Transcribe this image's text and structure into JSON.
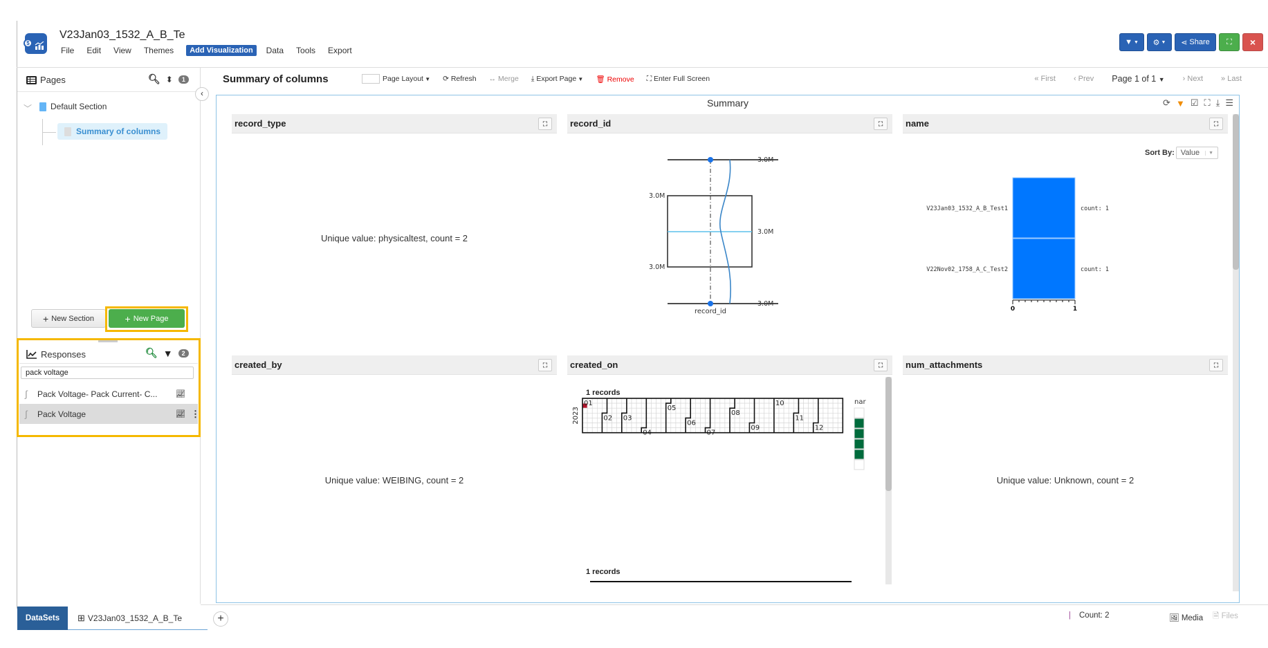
{
  "app": {
    "title": "V23Jan03_1532_A_B_Te",
    "menu": [
      "File",
      "Edit",
      "View",
      "Themes",
      "Add Visualization",
      "Data",
      "Tools",
      "Export"
    ],
    "active_menu": "Add Visualization",
    "top_buttons": {
      "filter": "filter-dropdown",
      "settings": "settings-dropdown",
      "share": "Share",
      "fullscreen": "fullscreen",
      "close": "×"
    }
  },
  "sidebar": {
    "pages_label": "Pages",
    "pages_badge": "1",
    "section": "Default Section",
    "page": "Summary of columns",
    "new_section": "New Section",
    "new_page": "New Page",
    "responses_label": "Responses",
    "responses_badge": "2",
    "search_value": "pack voltage",
    "responses": [
      {
        "name": "Pack Voltage- Pack Current- C...",
        "selected": false
      },
      {
        "name": "Pack Voltage",
        "selected": true
      }
    ]
  },
  "toolbar": {
    "page_title": "Summary of columns",
    "page_layout": "Page Layout",
    "refresh": "Refresh",
    "merge": "Merge",
    "export_page": "Export Page",
    "remove": "Remove",
    "full_screen": "Enter Full Screen",
    "first": "First",
    "prev": "Prev",
    "page_indicator": "Page 1 of 1",
    "next": "Next",
    "last": "Last"
  },
  "summary": {
    "title": "Summary",
    "panels": {
      "record_type": {
        "title": "record_type",
        "text": "Unique value: physicaltest, count = 2"
      },
      "record_id": {
        "title": "record_id"
      },
      "name": {
        "title": "name",
        "sort_by_label": "Sort By:",
        "sort_by_value": "Value"
      },
      "created_by": {
        "title": "created_by",
        "text": "Unique value: WEIBING, count = 2"
      },
      "created_on": {
        "title": "created_on",
        "records_top": "1 records",
        "records_bottom": "1 records",
        "year": "2023",
        "legend_label": "nar"
      },
      "num_attachments": {
        "title": "num_attachments",
        "text": "Unique value: Unknown, count = 2"
      }
    }
  },
  "chart_data": [
    {
      "type": "box",
      "title": "record_id",
      "xlabel": "record_id",
      "labels": {
        "max": "3.0M",
        "q3": "3.0M",
        "median": "3.0M",
        "q1": "3.0M",
        "min": "3.0M"
      },
      "colors": {
        "median": "#5bc0eb",
        "density": "#3a86c8",
        "points": "#1a73e8"
      }
    },
    {
      "type": "bar",
      "title": "name",
      "orientation": "horizontal",
      "categories": [
        "V23Jan03_1532_A_B_Test1",
        "V22Nov02_1758_A_C_Test2"
      ],
      "values": [
        1,
        1
      ],
      "value_labels": [
        "count: 1",
        "count: 1"
      ],
      "xlim": [
        0,
        1
      ],
      "x_ticks": [
        "0",
        "1"
      ],
      "color": "#0077ff"
    },
    {
      "type": "heatmap",
      "title": "created_on",
      "year": "2023",
      "months": [
        "01",
        "02",
        "03",
        "04",
        "05",
        "06",
        "07",
        "08",
        "09",
        "10",
        "11",
        "12"
      ],
      "highlighted_day": "2023-01-02",
      "highlight_color": "#b5122b",
      "legend_color": "#006b3c"
    }
  ],
  "bottom": {
    "datasets_label": "DataSets",
    "dataset_name": "V23Jan03_1532_A_B_Te",
    "count": "Count: 2",
    "media": "Media",
    "files": "Files"
  }
}
